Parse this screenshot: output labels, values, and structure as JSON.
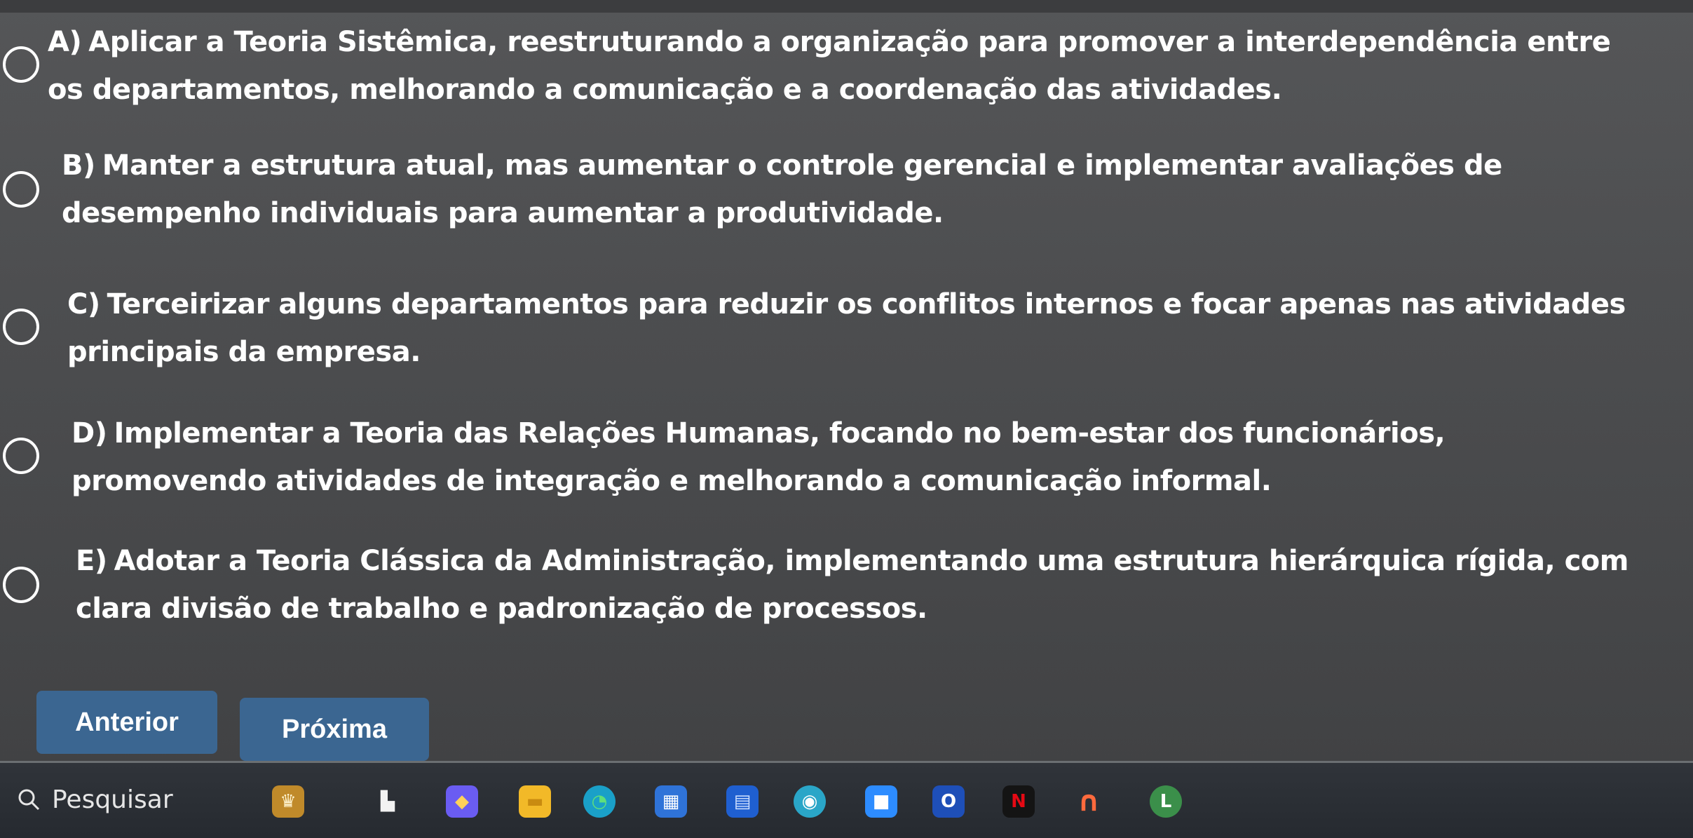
{
  "question": {
    "options": [
      {
        "letter": "A)",
        "lines": [
          "Aplicar a Teoria Sistêmica, reestruturando a organização para promover a interdependência entre",
          "os departamentos, melhorando a comunicação e a coordenação das atividades."
        ]
      },
      {
        "letter": "B)",
        "lines": [
          "Manter a estrutura atual, mas aumentar o controle gerencial e implementar avaliações de",
          "desempenho individuais para aumentar a produtividade."
        ]
      },
      {
        "letter": "C)",
        "lines": [
          "Terceirizar alguns departamentos para reduzir os conflitos internos e focar apenas nas atividades",
          "principais da empresa."
        ]
      },
      {
        "letter": "D)",
        "lines": [
          "Implementar a Teoria das Relações Humanas, focando no bem-estar dos funcionários,",
          "promovendo atividades de integração e melhorando a comunicação informal."
        ]
      },
      {
        "letter": "E)",
        "lines": [
          "Adotar a Teoria Clássica da Administração, implementando uma estrutura hierárquica rígida, com",
          "clara divisão de trabalho e padronização de processos."
        ]
      }
    ]
  },
  "nav": {
    "prev_label": "Anterior",
    "next_label": "Próxima"
  },
  "taskbar": {
    "search_placeholder": "Pesquisar",
    "apps": [
      {
        "name": "widgets-icon",
        "glyph": "♛"
      },
      {
        "name": "task-view-icon",
        "glyph": "▙"
      },
      {
        "name": "copilot-icon",
        "glyph": "◆"
      },
      {
        "name": "file-explorer-icon",
        "glyph": "▬"
      },
      {
        "name": "edge-browser-icon",
        "glyph": "◔"
      },
      {
        "name": "microsoft-store-icon",
        "glyph": "▦"
      },
      {
        "name": "calculator-icon",
        "glyph": "▤"
      },
      {
        "name": "messaging-app-icon",
        "glyph": "◉"
      },
      {
        "name": "zoom-icon",
        "glyph": "■"
      },
      {
        "name": "office-app-icon",
        "glyph": "O"
      },
      {
        "name": "netflix-icon",
        "glyph": "N"
      },
      {
        "name": "arc-app-icon",
        "glyph": "∩"
      },
      {
        "name": "chrome-profile-icon",
        "glyph": "L"
      }
    ]
  },
  "colors": {
    "button": "#3b6691",
    "text": "#ffffff",
    "taskbar": "#2a2e34"
  }
}
